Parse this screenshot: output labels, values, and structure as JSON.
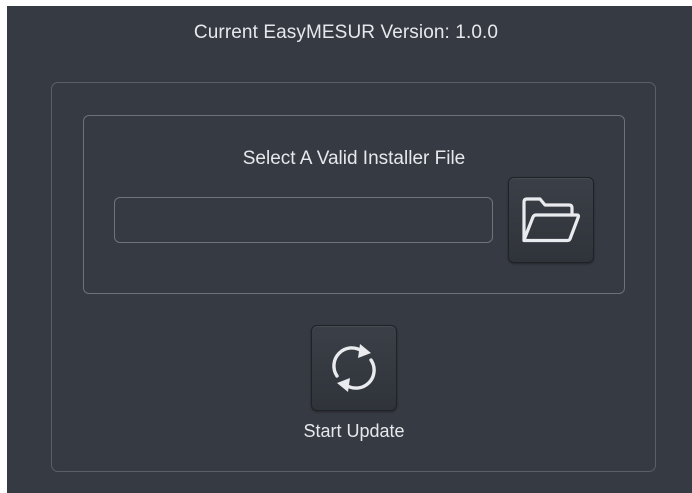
{
  "header": {
    "version_text": "Current EasyMESUR Version: 1.0.0"
  },
  "installer": {
    "select_label": "Select A Valid Installer File",
    "file_path_value": "",
    "browse_icon": "folder-open-icon"
  },
  "update": {
    "start_label": "Start Update",
    "icon": "refresh-icon"
  },
  "colors": {
    "background": "#363a42",
    "text": "#e6e8ec",
    "panel_border": "#5a5f69"
  }
}
